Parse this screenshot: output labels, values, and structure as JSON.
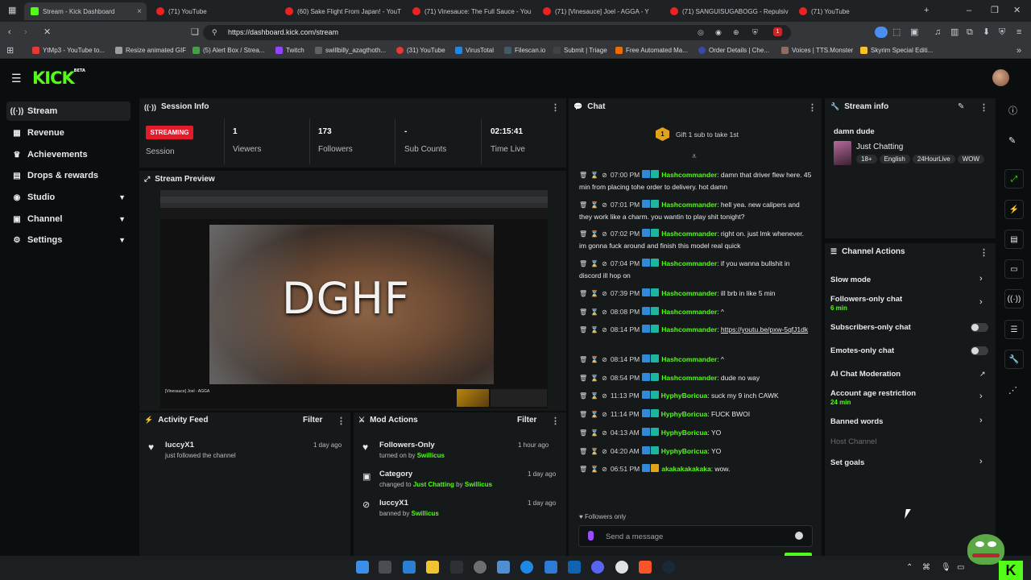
{
  "browser": {
    "tabs": [
      {
        "title": "Stream - Kick Dashboard",
        "active": true
      },
      {
        "title": "(71) YouTube"
      },
      {
        "title": "(60) Sake Flight From Japan! - YouT"
      },
      {
        "title": "(71) Vinesauce: The Full Sauce - You"
      },
      {
        "title": "(71) [Vinesauce] Joel - AGGA - Y"
      },
      {
        "title": "(71) SANGUISUGABOGG - Repulsiv"
      },
      {
        "title": "(71) YouTube"
      }
    ],
    "url": "https://dashboard.kick.com/stream",
    "bookmarks": [
      "YtMp3 - YouTube to...",
      "Resize animated GIF",
      "(5) Alert Box / Strea...",
      "Twitch",
      "swillbilly_azagthoth...",
      "(31) YouTube",
      "VirusTotal",
      "Filescan.io",
      "Submit | Triage",
      "Free Automated Ma...",
      "Order Details | Che...",
      "Voices | TTS.Monster",
      "Skyrim Special Editi..."
    ],
    "extension_badge": "1"
  },
  "kick": {
    "logo": "KICK",
    "logo_sup": "BETA"
  },
  "sidebar": {
    "items": [
      {
        "label": "Stream",
        "icon": "broadcast-icon",
        "active": true
      },
      {
        "label": "Revenue",
        "icon": "revenue-icon"
      },
      {
        "label": "Achievements",
        "icon": "trophy-icon"
      },
      {
        "label": "Drops & rewards",
        "icon": "gift-icon"
      },
      {
        "label": "Studio",
        "icon": "studio-icon",
        "expandable": true
      },
      {
        "label": "Channel",
        "icon": "channel-icon",
        "expandable": true
      },
      {
        "label": "Settings",
        "icon": "gear-icon",
        "expandable": true
      }
    ]
  },
  "session": {
    "title": "Session Info",
    "status": "STREAMING",
    "status_label": "Session",
    "viewers": "1",
    "viewers_label": "Viewers",
    "followers": "173",
    "followers_label": "Followers",
    "subs": "-",
    "subs_label": "Sub Counts",
    "time": "02:15:41",
    "time_label": "Time Live"
  },
  "preview": {
    "title": "Stream Preview",
    "overlay_text": "DGHF",
    "video_title": "[Vinesauce] Joel - AGGA"
  },
  "activity": {
    "title": "Activity Feed",
    "filter": "Filter",
    "items": [
      {
        "name": "luccyX1",
        "detail": "just followed the channel",
        "time": "1 day ago"
      }
    ]
  },
  "mod": {
    "title": "Mod Actions",
    "filter": "Filter",
    "items": [
      {
        "name": "Followers-Only",
        "pre": "turned on by",
        "mid": "",
        "link": "",
        "by": "Swillicus",
        "time": "1 hour ago"
      },
      {
        "name": "Category",
        "pre": "changed to",
        "link": "Just Chatting",
        "mid": "by",
        "by": "Swillicus",
        "time": "1 day ago"
      },
      {
        "name": "luccyX1",
        "pre": "banned by",
        "mid": "",
        "link": "",
        "by": "Swillicus",
        "time": "1 day ago"
      }
    ]
  },
  "chat": {
    "title": "Chat",
    "gift_count": "1",
    "gift_text": "Gift 1 sub to take 1st",
    "messages": [
      {
        "time": "07:00 PM",
        "user": "Hashcommander",
        "text": "damn that driver flew here. 45 min from placing tohe order to delivery. hot damn"
      },
      {
        "time": "07:01 PM",
        "user": "Hashcommander",
        "text": "hell yea. new calipers and they work like a charm. you wantin to play shit tonight?"
      },
      {
        "time": "07:02 PM",
        "user": "Hashcommander",
        "text": "right on. just lmk whenever. im gonna fuck around and finish this model real quick"
      },
      {
        "time": "07:04 PM",
        "user": "Hashcommander",
        "text": "if you wanna bullshit in discord ill hop on"
      },
      {
        "time": "07:39 PM",
        "user": "Hashcommander",
        "text": "ill brb in like 5 min"
      },
      {
        "time": "08:08 PM",
        "user": "Hashcommander",
        "text": "^"
      },
      {
        "time": "08:14 PM",
        "user": "Hashcommander",
        "text": "https://youtu.be/pxw-5qfJ1dk",
        "link": true
      },
      {
        "time": "08:14 PM",
        "user": "Hashcommander",
        "text": "^"
      },
      {
        "time": "08:54 PM",
        "user": "Hashcommander",
        "text": "dude no way"
      },
      {
        "time": "11:13 PM",
        "user": "HyphyBoricua",
        "text": "suck my 9 inch CAWK"
      },
      {
        "time": "11:14 PM",
        "user": "HyphyBoricua",
        "text": "FUCK BWOI"
      },
      {
        "time": "04:13 AM",
        "user": "HyphyBoricua",
        "text": "YO"
      },
      {
        "time": "04:20 AM",
        "user": "HyphyBoricua",
        "text": "YO"
      },
      {
        "time": "06:51 PM",
        "user": "akakakakakaka",
        "text": "wow.",
        "gold": true
      }
    ],
    "mode_label": "Followers only",
    "input_placeholder": "Send a message"
  },
  "stream_info": {
    "title": "Stream info",
    "stream_title": "damn dude",
    "category": "Just Chatting",
    "tags": [
      "18+",
      "English",
      "24HourLive",
      "WOW"
    ]
  },
  "channel_actions": {
    "title": "Channel Actions",
    "items": [
      {
        "label": "Slow mode",
        "type": "arrow"
      },
      {
        "label": "Followers-only chat",
        "sub": "6 min",
        "type": "arrow"
      },
      {
        "label": "Subscribers-only chat",
        "type": "toggle"
      },
      {
        "label": "Emotes-only chat",
        "type": "toggle"
      },
      {
        "label": "AI Chat Moderation",
        "type": "external"
      },
      {
        "label": "Account age restriction",
        "sub": "24 min",
        "type": "arrow"
      },
      {
        "label": "Banned words",
        "type": "arrow"
      },
      {
        "label": "Host Channel",
        "type": "disabled"
      },
      {
        "label": "Set goals",
        "type": "arrow"
      }
    ]
  },
  "colors": {
    "accent": "#53fc18",
    "live": "#e31c2c",
    "panel": "#16191a",
    "background": "#0b0e0f"
  }
}
